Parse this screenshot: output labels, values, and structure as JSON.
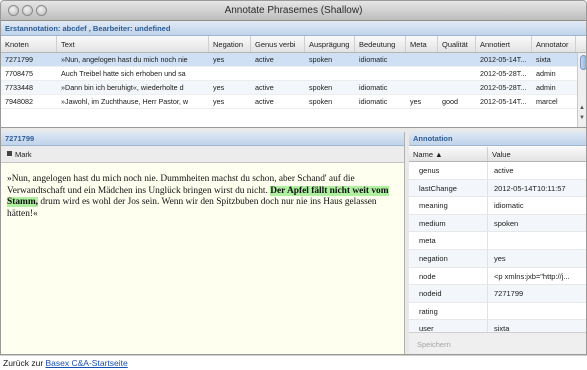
{
  "window": {
    "title": "Annotate Phrasemes (Shallow)"
  },
  "top_panel": {
    "header": "Erstannotation: abcdef , Bearbeiter: undefined"
  },
  "grid": {
    "columns": [
      "Knoten",
      "Text",
      "Negation",
      "Genus verbi",
      "Ausprägung",
      "Bedeutung",
      "Meta",
      "Qualität",
      "Annotiert",
      "Annotator"
    ],
    "rows": [
      [
        "7271799",
        "»Nun, angelogen hast du mich noch nie",
        "yes",
        "active",
        "spoken",
        "idiomatic",
        "",
        "",
        "2012-05-14T...",
        "sixta"
      ],
      [
        "7708475",
        "Auch Treibel hatte sich erhoben und sa",
        "",
        "",
        "",
        "",
        "",
        "",
        "2012-05-28T...",
        "admin"
      ],
      [
        "7733448",
        "»Dann bin ich beruhigt«, wiederholte d",
        "yes",
        "active",
        "spoken",
        "idiomatic",
        "",
        "",
        "2012-05-28T...",
        "admin"
      ],
      [
        "7948082",
        "»Jawohl, im Zuchthause, Herr Pastor, w",
        "yes",
        "active",
        "spoken",
        "idiomatic",
        "yes",
        "good",
        "2012-05-14T...",
        "marcel"
      ]
    ]
  },
  "text_panel": {
    "header": "7271799",
    "mark_label": "Mark",
    "text_before": "»Nun, angelogen hast du mich noch nie. Dummheiten machst du schon, aber Schand' auf die Verwandtschaft und ein Mädchen ins Unglück bringen wirst du nicht. ",
    "text_highlight": "Der Apfel fällt nicht weit vom Stamm,",
    "text_after": " drum wird es wohl der Jos sein. Wenn wir den Spitzbuben doch nur nie ins Haus gelassen hätten!«"
  },
  "annotation_panel": {
    "header": "Annotation",
    "col_name": "Name ▲",
    "col_value": "Value",
    "rows": [
      {
        "name": "genus",
        "value": "active"
      },
      {
        "name": "lastChange",
        "value": "2012-05-14T10:11:57"
      },
      {
        "name": "meaning",
        "value": "idiomatic"
      },
      {
        "name": "medium",
        "value": "spoken"
      },
      {
        "name": "meta",
        "value": ""
      },
      {
        "name": "negation",
        "value": "yes"
      },
      {
        "name": "node",
        "value": "<p xmlns:jxb=\"http://j..."
      },
      {
        "name": "nodeid",
        "value": "7271799"
      },
      {
        "name": "rating",
        "value": ""
      },
      {
        "name": "user",
        "value": "sixta"
      }
    ],
    "save_label": "Speichern"
  },
  "footer": {
    "prefix": "Zurück zur ",
    "link": "Basex C&A-Startseite"
  },
  "colors": {
    "accent": "#2f5d94",
    "highlight": "#aef0a0",
    "text_bg": "#fffff0",
    "selected_row": "#cfe0f5"
  }
}
